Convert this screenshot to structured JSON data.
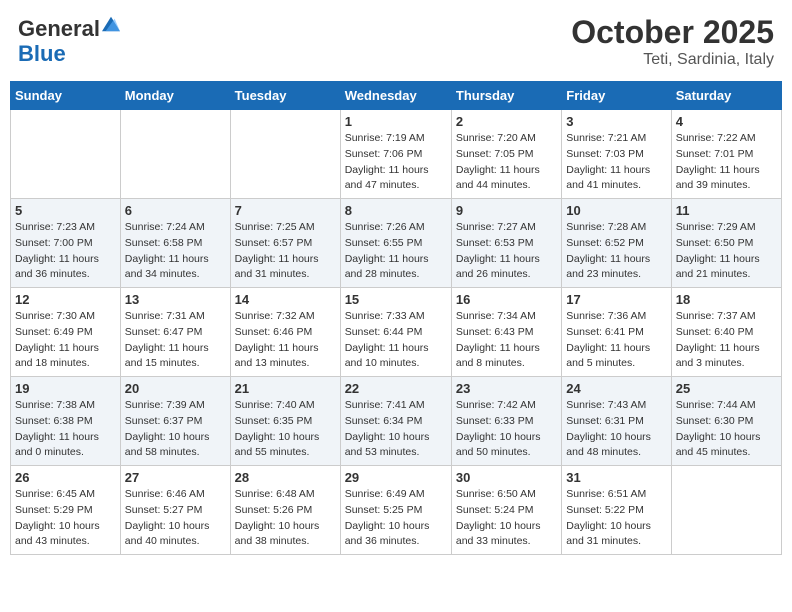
{
  "header": {
    "logo_general": "General",
    "logo_blue": "Blue",
    "month": "October 2025",
    "location": "Teti, Sardinia, Italy"
  },
  "days_of_week": [
    "Sunday",
    "Monday",
    "Tuesday",
    "Wednesday",
    "Thursday",
    "Friday",
    "Saturday"
  ],
  "weeks": [
    [
      {
        "day": "",
        "info": ""
      },
      {
        "day": "",
        "info": ""
      },
      {
        "day": "",
        "info": ""
      },
      {
        "day": "1",
        "info": "Sunrise: 7:19 AM\nSunset: 7:06 PM\nDaylight: 11 hours and 47 minutes."
      },
      {
        "day": "2",
        "info": "Sunrise: 7:20 AM\nSunset: 7:05 PM\nDaylight: 11 hours and 44 minutes."
      },
      {
        "day": "3",
        "info": "Sunrise: 7:21 AM\nSunset: 7:03 PM\nDaylight: 11 hours and 41 minutes."
      },
      {
        "day": "4",
        "info": "Sunrise: 7:22 AM\nSunset: 7:01 PM\nDaylight: 11 hours and 39 minutes."
      }
    ],
    [
      {
        "day": "5",
        "info": "Sunrise: 7:23 AM\nSunset: 7:00 PM\nDaylight: 11 hours and 36 minutes."
      },
      {
        "day": "6",
        "info": "Sunrise: 7:24 AM\nSunset: 6:58 PM\nDaylight: 11 hours and 34 minutes."
      },
      {
        "day": "7",
        "info": "Sunrise: 7:25 AM\nSunset: 6:57 PM\nDaylight: 11 hours and 31 minutes."
      },
      {
        "day": "8",
        "info": "Sunrise: 7:26 AM\nSunset: 6:55 PM\nDaylight: 11 hours and 28 minutes."
      },
      {
        "day": "9",
        "info": "Sunrise: 7:27 AM\nSunset: 6:53 PM\nDaylight: 11 hours and 26 minutes."
      },
      {
        "day": "10",
        "info": "Sunrise: 7:28 AM\nSunset: 6:52 PM\nDaylight: 11 hours and 23 minutes."
      },
      {
        "day": "11",
        "info": "Sunrise: 7:29 AM\nSunset: 6:50 PM\nDaylight: 11 hours and 21 minutes."
      }
    ],
    [
      {
        "day": "12",
        "info": "Sunrise: 7:30 AM\nSunset: 6:49 PM\nDaylight: 11 hours and 18 minutes."
      },
      {
        "day": "13",
        "info": "Sunrise: 7:31 AM\nSunset: 6:47 PM\nDaylight: 11 hours and 15 minutes."
      },
      {
        "day": "14",
        "info": "Sunrise: 7:32 AM\nSunset: 6:46 PM\nDaylight: 11 hours and 13 minutes."
      },
      {
        "day": "15",
        "info": "Sunrise: 7:33 AM\nSunset: 6:44 PM\nDaylight: 11 hours and 10 minutes."
      },
      {
        "day": "16",
        "info": "Sunrise: 7:34 AM\nSunset: 6:43 PM\nDaylight: 11 hours and 8 minutes."
      },
      {
        "day": "17",
        "info": "Sunrise: 7:36 AM\nSunset: 6:41 PM\nDaylight: 11 hours and 5 minutes."
      },
      {
        "day": "18",
        "info": "Sunrise: 7:37 AM\nSunset: 6:40 PM\nDaylight: 11 hours and 3 minutes."
      }
    ],
    [
      {
        "day": "19",
        "info": "Sunrise: 7:38 AM\nSunset: 6:38 PM\nDaylight: 11 hours and 0 minutes."
      },
      {
        "day": "20",
        "info": "Sunrise: 7:39 AM\nSunset: 6:37 PM\nDaylight: 10 hours and 58 minutes."
      },
      {
        "day": "21",
        "info": "Sunrise: 7:40 AM\nSunset: 6:35 PM\nDaylight: 10 hours and 55 minutes."
      },
      {
        "day": "22",
        "info": "Sunrise: 7:41 AM\nSunset: 6:34 PM\nDaylight: 10 hours and 53 minutes."
      },
      {
        "day": "23",
        "info": "Sunrise: 7:42 AM\nSunset: 6:33 PM\nDaylight: 10 hours and 50 minutes."
      },
      {
        "day": "24",
        "info": "Sunrise: 7:43 AM\nSunset: 6:31 PM\nDaylight: 10 hours and 48 minutes."
      },
      {
        "day": "25",
        "info": "Sunrise: 7:44 AM\nSunset: 6:30 PM\nDaylight: 10 hours and 45 minutes."
      }
    ],
    [
      {
        "day": "26",
        "info": "Sunrise: 6:45 AM\nSunset: 5:29 PM\nDaylight: 10 hours and 43 minutes."
      },
      {
        "day": "27",
        "info": "Sunrise: 6:46 AM\nSunset: 5:27 PM\nDaylight: 10 hours and 40 minutes."
      },
      {
        "day": "28",
        "info": "Sunrise: 6:48 AM\nSunset: 5:26 PM\nDaylight: 10 hours and 38 minutes."
      },
      {
        "day": "29",
        "info": "Sunrise: 6:49 AM\nSunset: 5:25 PM\nDaylight: 10 hours and 36 minutes."
      },
      {
        "day": "30",
        "info": "Sunrise: 6:50 AM\nSunset: 5:24 PM\nDaylight: 10 hours and 33 minutes."
      },
      {
        "day": "31",
        "info": "Sunrise: 6:51 AM\nSunset: 5:22 PM\nDaylight: 10 hours and 31 minutes."
      },
      {
        "day": "",
        "info": ""
      }
    ]
  ]
}
